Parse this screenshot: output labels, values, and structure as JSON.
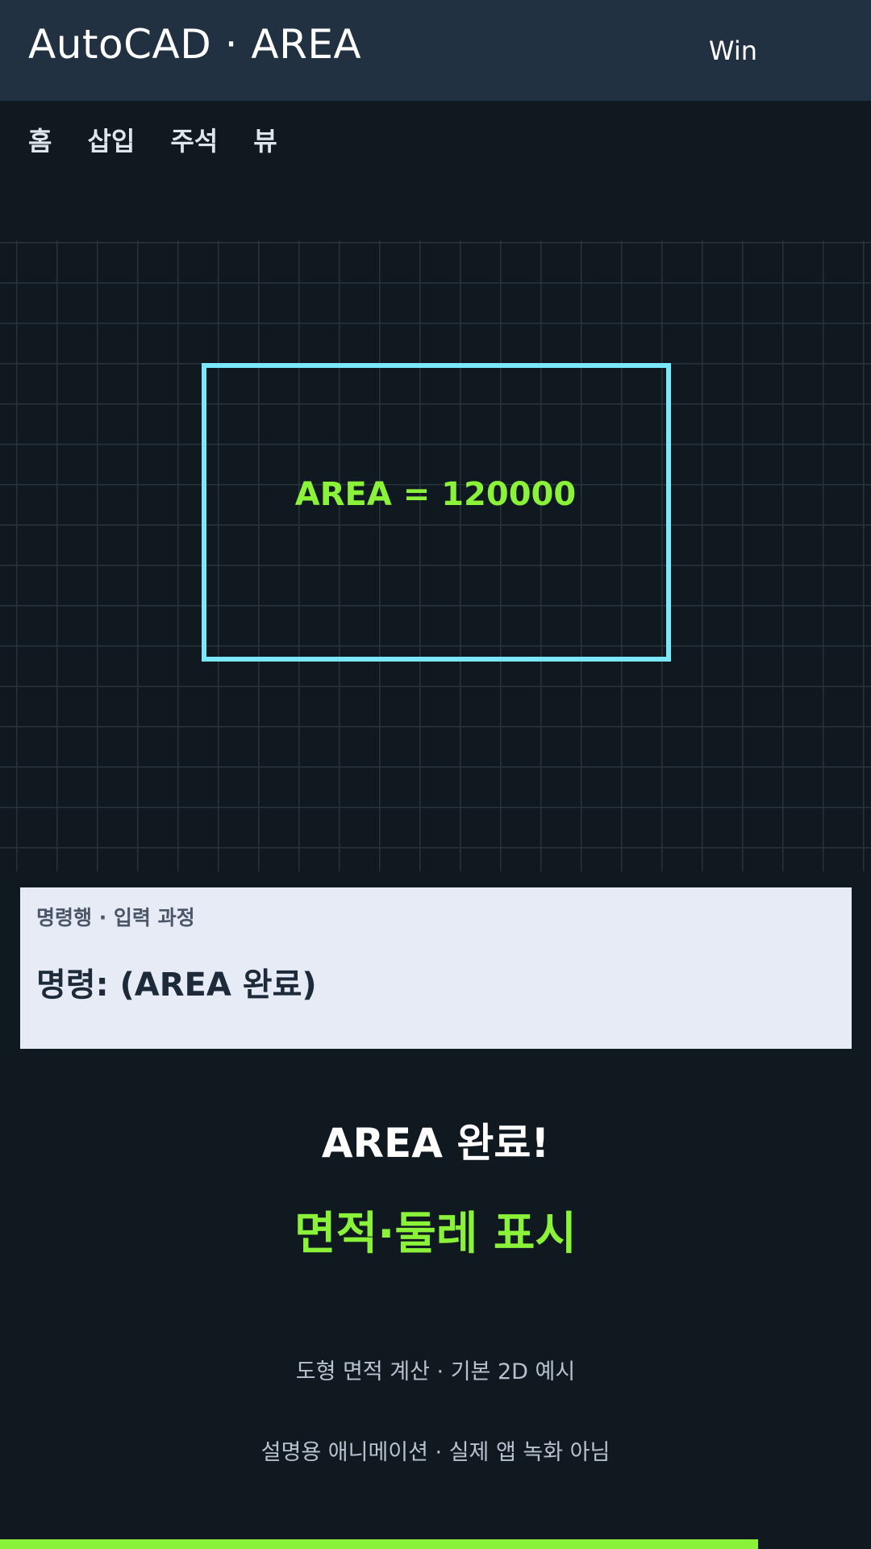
{
  "header": {
    "title": "AutoCAD · AREA",
    "platform": "Win"
  },
  "ribbon": {
    "tabs": [
      "홈",
      "삽입",
      "주석",
      "뷰"
    ]
  },
  "canvas": {
    "area_readout": "AREA = 120000"
  },
  "command_line": {
    "heading": "명령행 · 입력 과정",
    "text": "명령: (AREA 완료)"
  },
  "result": {
    "title": "AREA 완료!",
    "subtitle": "면적·둘레 표시"
  },
  "notes": {
    "line1": "도형 면적 계산 · 기본 2D 예시",
    "line2": "설명용 애니메이션 · 실제 앱 녹화 아님"
  },
  "progress": {
    "fraction": 0.87
  },
  "colors": {
    "accent_green": "#8bf23a",
    "shape_cyan": "#7be8f9",
    "titlebar": "#213142",
    "background": "#111920",
    "command_panel": "#e6ebf5"
  }
}
